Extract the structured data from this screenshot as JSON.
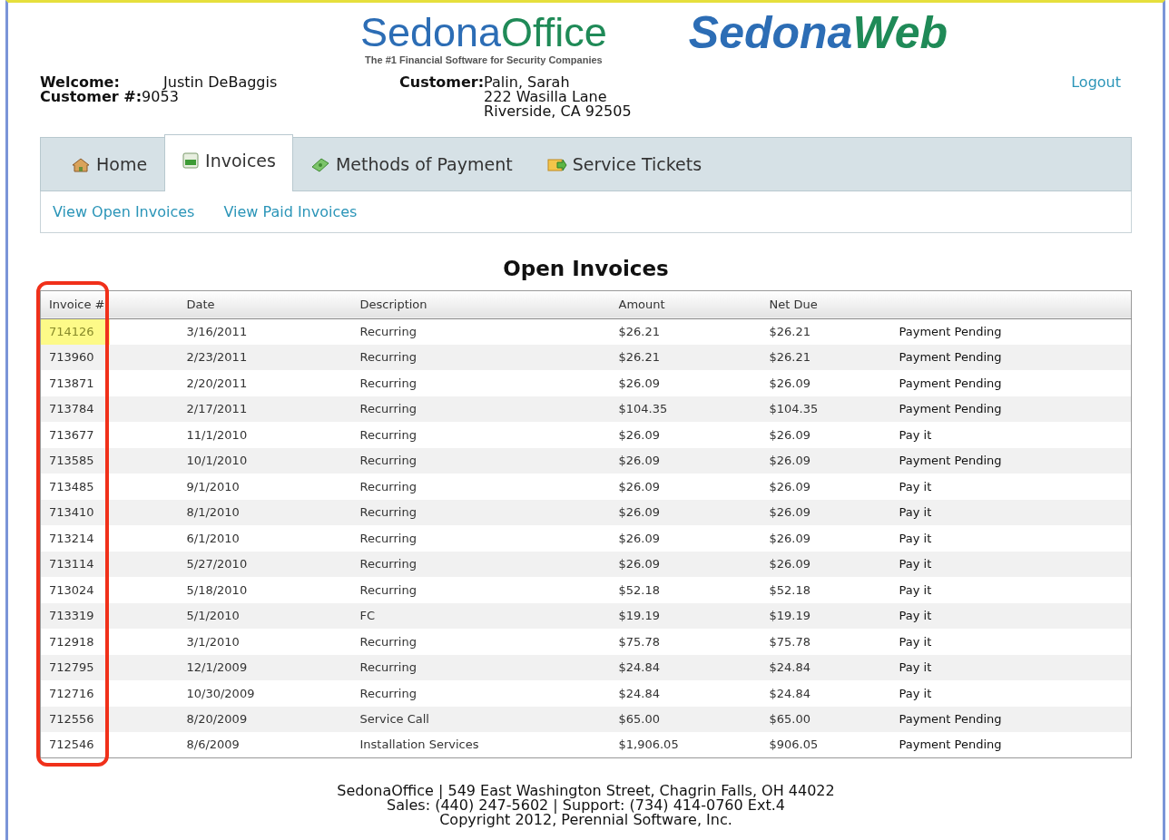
{
  "logo": {
    "parts": [
      "Sedona",
      "Office"
    ],
    "tagline": "The #1 Financial Software for Security Companies"
  },
  "product": {
    "parts": [
      "Sedona",
      "Web"
    ]
  },
  "welcome": {
    "label": "Welcome:",
    "value": "Justin DeBaggis"
  },
  "customer_number": {
    "label": "Customer #:",
    "value": "9053"
  },
  "customer": {
    "label": "Customer:",
    "lines": [
      "Palin, Sarah",
      "222 Wasilla Lane",
      "Riverside, CA 92505"
    ]
  },
  "logout": "Logout",
  "tabs": [
    {
      "label": "Home",
      "kind": "home",
      "selected": false
    },
    {
      "label": "Invoices",
      "kind": "invoice",
      "selected": true
    },
    {
      "label": "Methods of Payment",
      "kind": "money",
      "selected": false
    },
    {
      "label": "Service Tickets",
      "kind": "ticket",
      "selected": false
    }
  ],
  "subnav": [
    "View Open Invoices",
    "View Paid Invoices"
  ],
  "heading": "Open Invoices",
  "table": {
    "columns": [
      "Invoice #",
      "Date",
      "Description",
      "Amount",
      "Net Due"
    ],
    "rows": [
      {
        "cells": [
          "714126",
          "3/16/2011",
          "Recurring",
          "$26.21",
          "$26.21",
          "Payment Pending"
        ],
        "highlighted": true
      },
      {
        "cells": [
          "713960",
          "2/23/2011",
          "Recurring",
          "$26.21",
          "$26.21",
          "Payment Pending"
        ],
        "highlighted": false
      },
      {
        "cells": [
          "713871",
          "2/20/2011",
          "Recurring",
          "$26.09",
          "$26.09",
          "Payment Pending"
        ],
        "highlighted": false
      },
      {
        "cells": [
          "713784",
          "2/17/2011",
          "Recurring",
          "$104.35",
          "$104.35",
          "Payment Pending"
        ],
        "highlighted": false
      },
      {
        "cells": [
          "713677",
          "11/1/2010",
          "Recurring",
          "$26.09",
          "$26.09",
          "Pay it"
        ],
        "highlighted": false
      },
      {
        "cells": [
          "713585",
          "10/1/2010",
          "Recurring",
          "$26.09",
          "$26.09",
          "Payment Pending"
        ],
        "highlighted": false
      },
      {
        "cells": [
          "713485",
          "9/1/2010",
          "Recurring",
          "$26.09",
          "$26.09",
          "Pay it"
        ],
        "highlighted": false
      },
      {
        "cells": [
          "713410",
          "8/1/2010",
          "Recurring",
          "$26.09",
          "$26.09",
          "Pay it"
        ],
        "highlighted": false
      },
      {
        "cells": [
          "713214",
          "6/1/2010",
          "Recurring",
          "$26.09",
          "$26.09",
          "Pay it"
        ],
        "highlighted": false
      },
      {
        "cells": [
          "713114",
          "5/27/2010",
          "Recurring",
          "$26.09",
          "$26.09",
          "Pay it"
        ],
        "highlighted": false
      },
      {
        "cells": [
          "713024",
          "5/18/2010",
          "Recurring",
          "$52.18",
          "$52.18",
          "Pay it"
        ],
        "highlighted": false
      },
      {
        "cells": [
          "713319",
          "5/1/2010",
          "FC",
          "$19.19",
          "$19.19",
          "Pay it"
        ],
        "highlighted": false
      },
      {
        "cells": [
          "712918",
          "3/1/2010",
          "Recurring",
          "$75.78",
          "$75.78",
          "Pay it"
        ],
        "highlighted": false
      },
      {
        "cells": [
          "712795",
          "12/1/2009",
          "Recurring",
          "$24.84",
          "$24.84",
          "Pay it"
        ],
        "highlighted": false
      },
      {
        "cells": [
          "712716",
          "10/30/2009",
          "Recurring",
          "$24.84",
          "$24.84",
          "Pay it"
        ],
        "highlighted": false
      },
      {
        "cells": [
          "712556",
          "8/20/2009",
          "Service Call",
          "$65.00",
          "$65.00",
          "Payment Pending"
        ],
        "highlighted": false
      },
      {
        "cells": [
          "712546",
          "8/6/2009",
          "Installation Services",
          "$1,906.05",
          "$906.05",
          "Payment Pending"
        ],
        "highlighted": false
      }
    ]
  },
  "footer": [
    "SedonaOffice | 549 East Washington Street, Chagrin Falls, OH 44022",
    "Sales: (440) 247-5602 | Support: (734) 414-0760 Ext.4",
    "Copyright 2012, Perennial Software, Inc."
  ]
}
